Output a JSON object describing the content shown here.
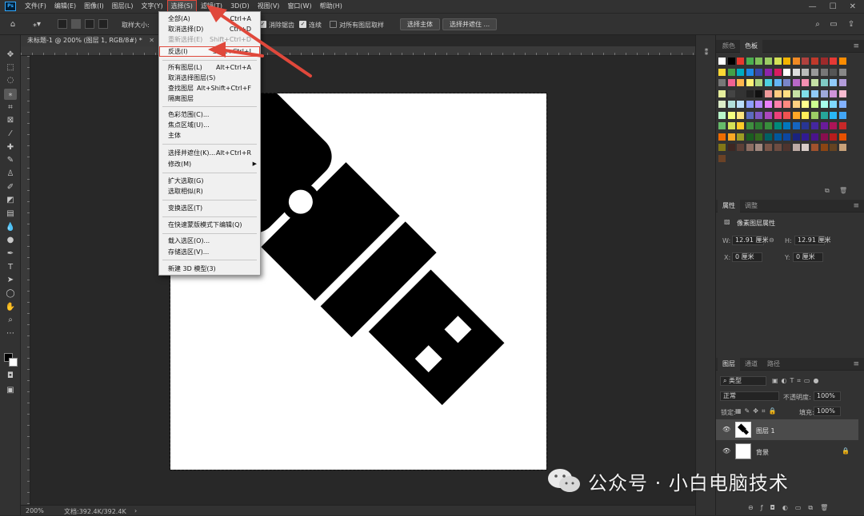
{
  "app": {
    "logo": "Ps"
  },
  "menubar": {
    "items": [
      "文件(F)",
      "编辑(E)",
      "图像(I)",
      "图层(L)",
      "文字(Y)",
      "选择(S)",
      "滤镜(T)",
      "3D(D)",
      "视图(V)",
      "窗口(W)",
      "帮助(H)"
    ],
    "active_index": 5
  },
  "optionsbar": {
    "sample_size_label": "取样大小:",
    "anti_alias_label": "消除锯齿",
    "contiguous_label": "连续",
    "all_layers_label": "对所有图层取样",
    "select_subject_label": "选择主体",
    "select_mask_label": "选择并遮住 ..."
  },
  "document": {
    "tab_title": "未标题-1 @ 200% (图层 1, RGB/8#) *",
    "zoom": "200%",
    "doc_info": "文档:392.4K/392.4K"
  },
  "select_menu": {
    "items": [
      {
        "label": "全部(A)",
        "shortcut": "Ctrl+A"
      },
      {
        "label": "取消选择(D)",
        "shortcut": "Ctrl+D"
      },
      {
        "label": "重新选择(E)",
        "shortcut": "Shift+Ctrl+D",
        "disabled": true
      },
      {
        "label": "反选(I)",
        "shortcut": "Shift+Ctrl+I",
        "highlight": true
      },
      {
        "label": "所有图层(L)",
        "shortcut": "Alt+Ctrl+A"
      },
      {
        "label": "取消选择图层(S)",
        "shortcut": ""
      },
      {
        "label": "查找图层",
        "shortcut": "Alt+Shift+Ctrl+F"
      },
      {
        "label": "隔离图层",
        "shortcut": ""
      },
      {
        "label": "色彩范围(C)...",
        "shortcut": ""
      },
      {
        "label": "焦点区域(U)...",
        "shortcut": ""
      },
      {
        "label": "主体",
        "shortcut": ""
      },
      {
        "label": "选择并遮住(K)...",
        "shortcut": "Alt+Ctrl+R"
      },
      {
        "label": "修改(M)",
        "shortcut": "",
        "submenu": true
      },
      {
        "label": "扩大选取(G)",
        "shortcut": ""
      },
      {
        "label": "选取相似(R)",
        "shortcut": ""
      },
      {
        "label": "变换选区(T)",
        "shortcut": ""
      },
      {
        "label": "在快速蒙版模式下编辑(Q)",
        "shortcut": ""
      },
      {
        "label": "载入选区(O)...",
        "shortcut": ""
      },
      {
        "label": "存储选区(V)...",
        "shortcut": ""
      },
      {
        "label": "新建 3D 模型(3)",
        "shortcut": ""
      }
    ]
  },
  "swatches_panel": {
    "tabs": [
      "颜色",
      "色板"
    ],
    "active_tab": 1
  },
  "properties_panel": {
    "tabs": [
      "属性",
      "调整"
    ],
    "active_tab": 0,
    "section_title": "像素图层属性",
    "w_label": "W:",
    "w_value": "12.91 厘米",
    "h_label": "H:",
    "h_value": "12.91 厘米",
    "x_label": "X:",
    "x_value": "0 厘米",
    "y_label": "Y:",
    "y_value": "0 厘米"
  },
  "layers_panel": {
    "tabs": [
      "图层",
      "通道",
      "路径"
    ],
    "active_tab": 0,
    "filter_kind": "类型",
    "blend_mode": "正常",
    "opacity_label": "不透明度:",
    "opacity_value": "100%",
    "lock_label": "锁定:",
    "fill_label": "填充:",
    "fill_value": "100%",
    "layers": [
      {
        "name": "图层 1",
        "selected": true
      },
      {
        "name": "背景",
        "locked": true
      }
    ]
  },
  "watermark": {
    "text": "公众号 · 小白电脑技术"
  },
  "colors": {
    "accent_red": "#e0483b",
    "swatches": [
      "#ffffff",
      "#000000",
      "#e8392e",
      "#4caf50",
      "#7fbf5a",
      "#9ccc65",
      "#d4e157",
      "#f4b400",
      "#f08a24",
      "#b0413e",
      "#c0392b",
      "#9e2a2b",
      "#e53935",
      "#fb8c00",
      "#fdd835",
      "#43a047",
      "#00acc1",
      "#1e88e5",
      "#3949ab",
      "#8e24aa",
      "#d81b60",
      "#ffffff",
      "#dddddd",
      "#bbbbbb",
      "#999999",
      "#777777",
      "#555555",
      "#888888",
      "#777777",
      "#f06292",
      "#ffb74d",
      "#fff176",
      "#aed581",
      "#4dd0e1",
      "#64b5f6",
      "#7986cb",
      "#ba68c8",
      "#f48fb1",
      "#c5e1a5",
      "#80cbc4",
      "#90caf9",
      "#b39ddb",
      "#e6ee9c",
      "#444444",
      "#333333",
      "#222222",
      "#111111",
      "#ef9a9a",
      "#ffcc80",
      "#ffe082",
      "#c5e1a5",
      "#80deea",
      "#90caf9",
      "#9fa8da",
      "#ce93d8",
      "#f8bbd0",
      "#dcedc8",
      "#b2dfdb",
      "#bbdefb",
      "#8c9eff",
      "#b388ff",
      "#ea80fc",
      "#ff80ab",
      "#ff8a80",
      "#ffd180",
      "#ffff8d",
      "#ccff90",
      "#a7ffeb",
      "#80d8ff",
      "#82b1ff",
      "#b9f6ca",
      "#f4ff81",
      "#ffe57f",
      "#5c6bc0",
      "#7e57c2",
      "#ab47bc",
      "#ec407a",
      "#ef5350",
      "#ffa726",
      "#ffee58",
      "#9ccc65",
      "#26a69a",
      "#29b6f6",
      "#42a5f5",
      "#66bb6a",
      "#d4e157",
      "#ffca28",
      "#3f8f3f",
      "#2e7d32",
      "#388e3c",
      "#00897b",
      "#0277bd",
      "#1565c0",
      "#283593",
      "#4527a0",
      "#6a1b9a",
      "#ad1457",
      "#c62828",
      "#ef6c00",
      "#f9a825",
      "#9e9d24",
      "#1b5e20",
      "#33691e",
      "#006064",
      "#01579b",
      "#0d47a1",
      "#1a237e",
      "#311b92",
      "#4a148c",
      "#880e4f",
      "#b71c1c",
      "#e65100",
      "#827717",
      "#3e2723",
      "#5d4037",
      "#8d6e63",
      "#a1887f",
      "#795548",
      "#6d4c41",
      "#4e342e",
      "#bcaaa4",
      "#d7ccc8",
      "#a0522d",
      "#8b4513",
      "#654321",
      "#c8a27a",
      "#6b4226"
    ]
  }
}
